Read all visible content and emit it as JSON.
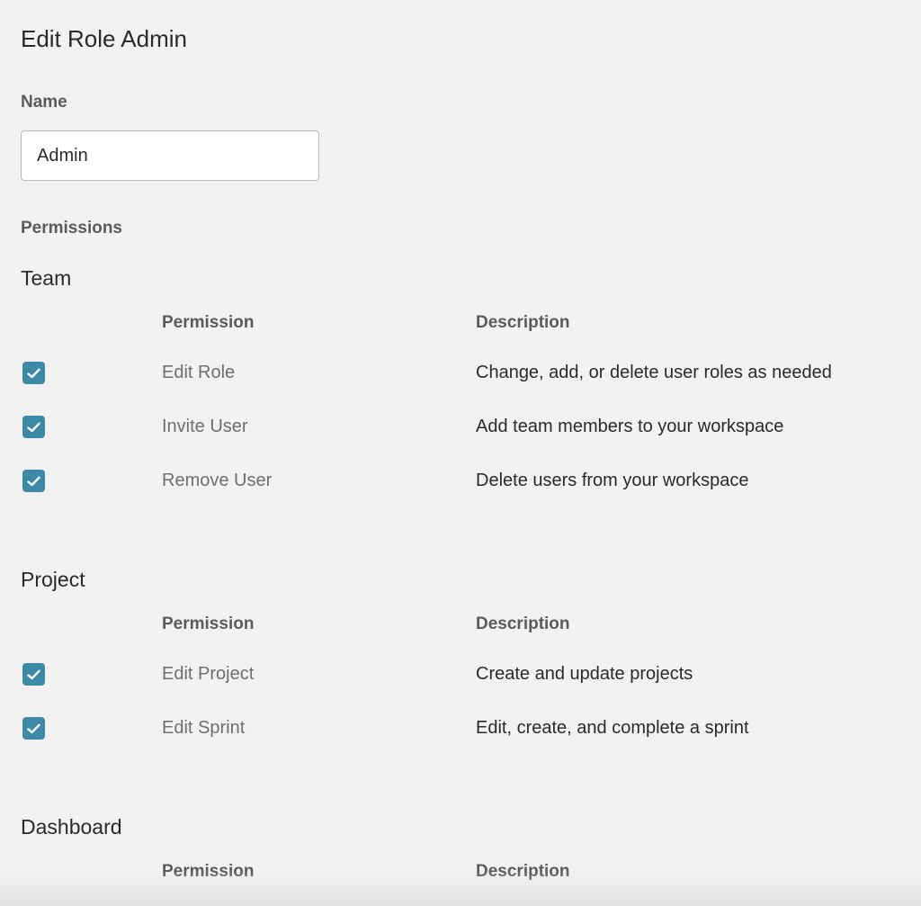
{
  "page": {
    "title": "Edit Role Admin",
    "name_label": "Name",
    "name_value": "Admin",
    "permissions_label": "Permissions"
  },
  "colors": {
    "checkbox_accent": "#3d8aa6",
    "background": "#f2f2f2"
  },
  "icons": {
    "checkbox": "check-icon"
  },
  "sections": [
    {
      "title": "Team",
      "permission_header": "Permission",
      "description_header": "Description",
      "rows": [
        {
          "name": "Edit Role",
          "description": "Change, add, or delete user roles as needed",
          "checked": true
        },
        {
          "name": "Invite User",
          "description": "Add team members to your workspace",
          "checked": true
        },
        {
          "name": "Remove User",
          "description": "Delete users from your workspace",
          "checked": true
        }
      ]
    },
    {
      "title": "Project",
      "permission_header": "Permission",
      "description_header": "Description",
      "rows": [
        {
          "name": "Edit Project",
          "description": "Create and update projects",
          "checked": true
        },
        {
          "name": "Edit Sprint",
          "description": "Edit, create, and complete a sprint",
          "checked": true
        }
      ]
    },
    {
      "title": "Dashboard",
      "permission_header": "Permission",
      "description_header": "Description",
      "rows": []
    }
  ]
}
